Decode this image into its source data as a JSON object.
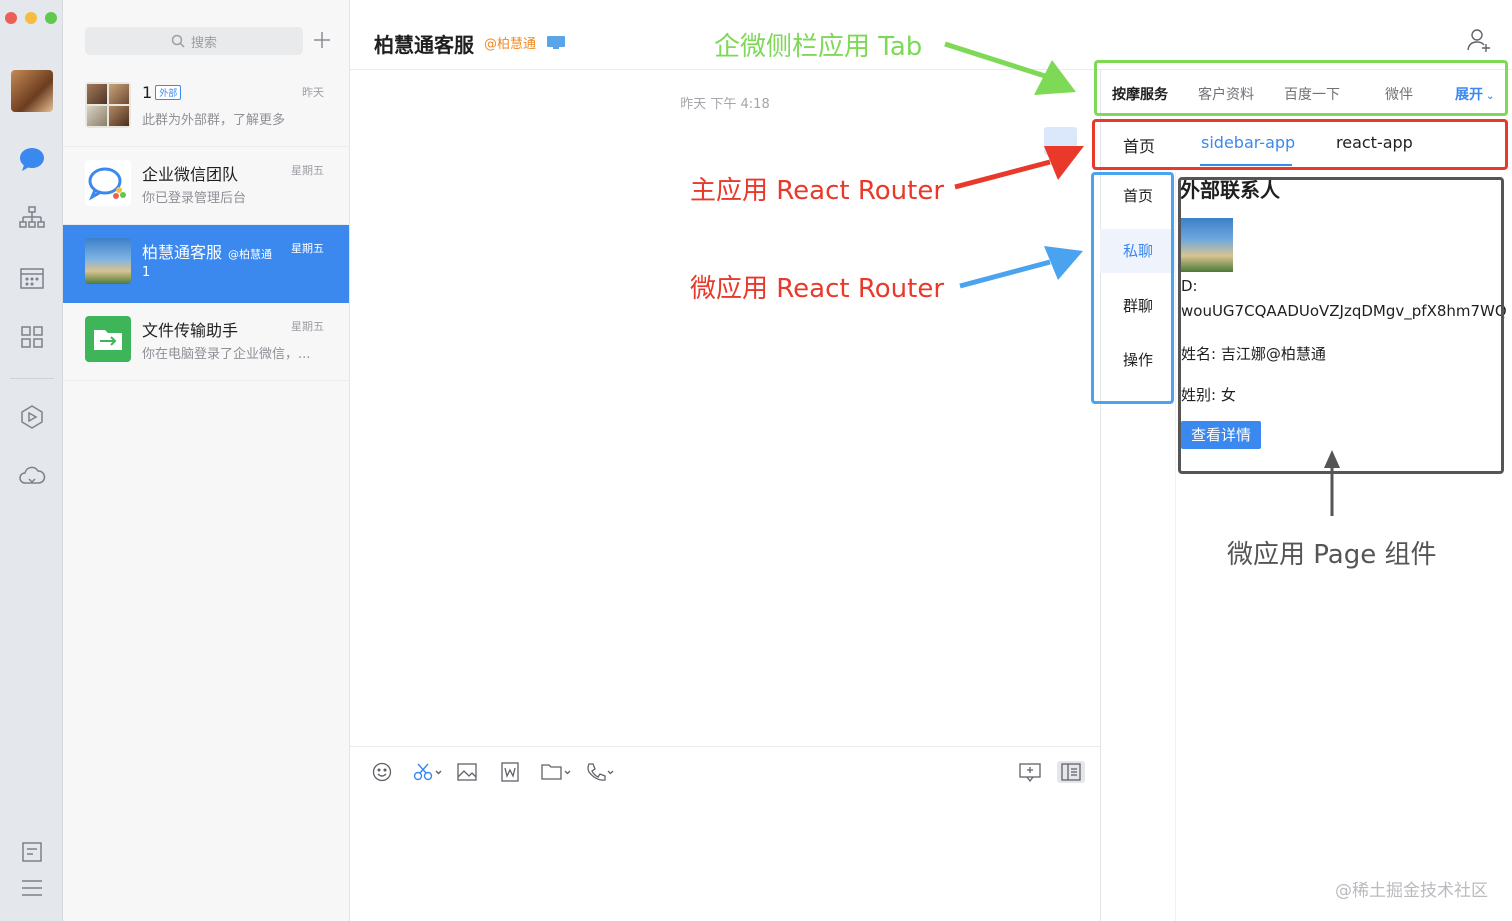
{
  "window": {
    "title": "柏慧通客服",
    "corp": "@柏慧通"
  },
  "search": {
    "placeholder": "搜索"
  },
  "conversations": [
    {
      "name": "1",
      "tag": "外部",
      "time": "昨天",
      "preview": "此群为外部群，了解更多"
    },
    {
      "name": "企业微信团队",
      "time": "星期五",
      "preview": "你已登录管理后台"
    },
    {
      "name": "柏慧通客服",
      "corp": "@柏慧通",
      "time": "星期五",
      "preview": "1",
      "active": true
    },
    {
      "name": "文件传输助手",
      "time": "星期五",
      "preview": "你在电脑登录了企业微信，..."
    }
  ],
  "chat": {
    "timestamp": "昨天 下午 4:18"
  },
  "sidebar_tabs": {
    "items": [
      "按摩服务",
      "客户资料",
      "百度一下",
      "微伴"
    ],
    "expand": "展开",
    "current": "按摩服务"
  },
  "main_router": {
    "tabs": [
      "首页",
      "sidebar-app",
      "react-app"
    ],
    "current": "sidebar-app"
  },
  "micro_router": {
    "items": [
      "首页",
      "私聊",
      "群聊",
      "操作"
    ],
    "current": "私聊"
  },
  "page": {
    "title": "外部联系人",
    "id_label": "D:",
    "id_value": "wouUG7CQAADUoVZJzqDMgv_pfX8hm7WQ",
    "name_line": "姓名: 吉江娜@柏慧通",
    "gender_line": "姓别: 女",
    "button": "查看详情"
  },
  "annotations": {
    "sidebar_tab": "企微侧栏应用 Tab",
    "main_router": "主应用 React Router",
    "micro_router": "微应用 React Router",
    "page_component": "微应用 Page 组件"
  },
  "watermark": "@稀土掘金技术社区",
  "colors": {
    "accent": "#3b88ef",
    "annotation_green": "#7ed957",
    "annotation_red": "#e8392b",
    "annotation_blue": "#4aa3ef",
    "annotation_gray": "#555555"
  },
  "icons": [
    "chat-icon",
    "org-icon",
    "calendar-icon",
    "apps-icon",
    "hexagon-icon",
    "cloud-icon",
    "doc-icon",
    "menu-icon",
    "search-icon",
    "plus-icon",
    "emoji-icon",
    "scissors-icon",
    "image-icon",
    "word-icon",
    "folder-icon",
    "phone-icon",
    "chat-bubble-icon",
    "sidebar-icon",
    "add-contact-icon",
    "monitor-icon"
  ]
}
